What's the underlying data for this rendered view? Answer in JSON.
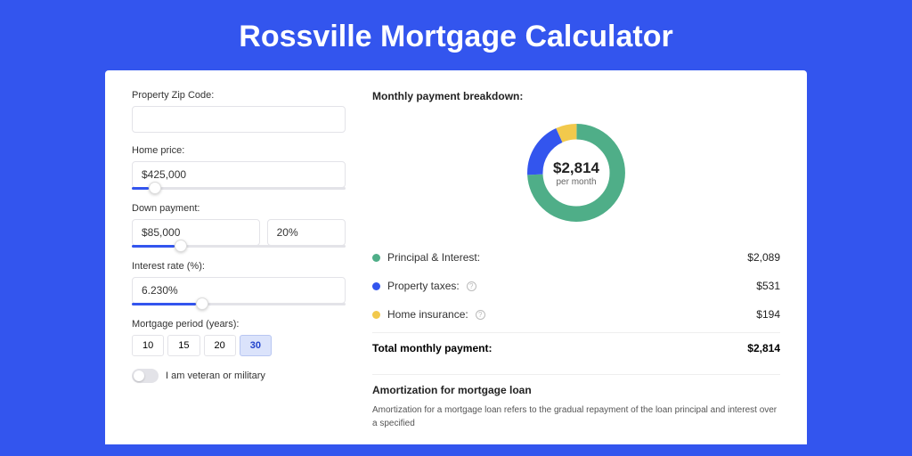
{
  "title": "Rossville Mortgage Calculator",
  "form": {
    "zip": {
      "label": "Property Zip Code:",
      "value": ""
    },
    "home_price": {
      "label": "Home price:",
      "value": "$425,000",
      "slider_pct": 8
    },
    "down_payment": {
      "label": "Down payment:",
      "amount": "$85,000",
      "percent": "20%",
      "slider_pct": 20
    },
    "interest": {
      "label": "Interest rate (%):",
      "value": "6.230%",
      "slider_pct": 30
    },
    "period": {
      "label": "Mortgage period (years):",
      "options": [
        "10",
        "15",
        "20",
        "30"
      ],
      "selected": "30"
    },
    "veteran": {
      "label": "I am veteran or military",
      "on": false
    }
  },
  "breakdown": {
    "heading": "Monthly payment breakdown:",
    "center_amount": "$2,814",
    "center_sub": "per month",
    "items": [
      {
        "label": "Principal & Interest:",
        "value": "$2,089",
        "color": "#4fae88",
        "help": false
      },
      {
        "label": "Property taxes:",
        "value": "$531",
        "color": "#3355ee",
        "help": true
      },
      {
        "label": "Home insurance:",
        "value": "$194",
        "color": "#f2c94c",
        "help": true
      }
    ],
    "total_label": "Total monthly payment:",
    "total_value": "$2,814"
  },
  "amortization": {
    "heading": "Amortization for mortgage loan",
    "text": "Amortization for a mortgage loan refers to the gradual repayment of the loan principal and interest over a specified"
  },
  "chart_data": {
    "type": "pie",
    "title": "Monthly payment breakdown",
    "categories": [
      "Principal & Interest",
      "Property taxes",
      "Home insurance"
    ],
    "values": [
      2089,
      531,
      194
    ],
    "colors": [
      "#4fae88",
      "#3355ee",
      "#f2c94c"
    ],
    "total": 2814
  }
}
